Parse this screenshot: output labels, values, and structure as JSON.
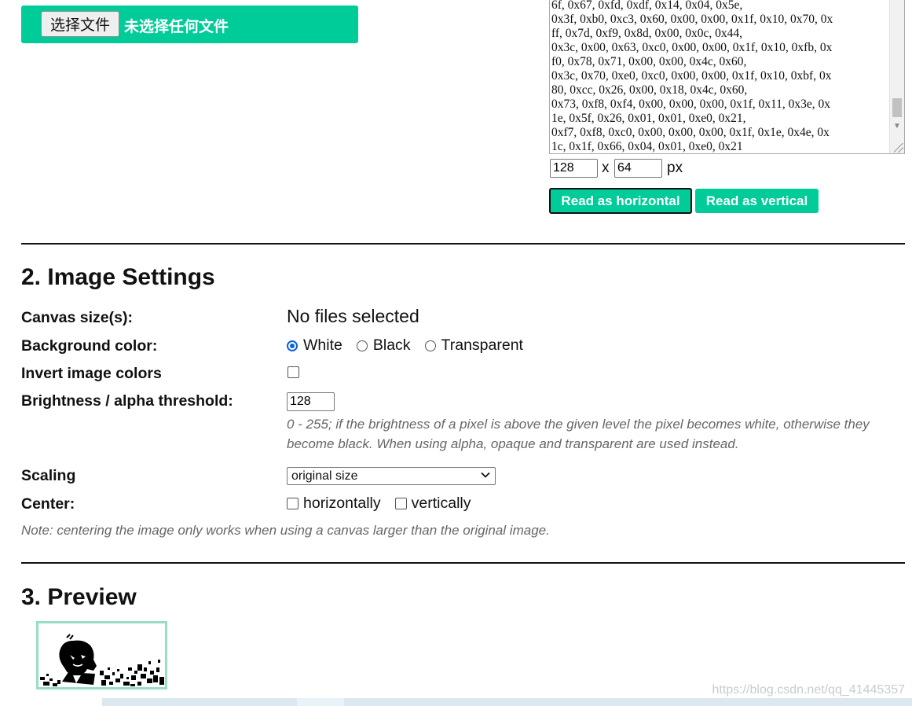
{
  "file_bar": {
    "choose_button": "选择文件",
    "no_file_text": "未选择任何文件"
  },
  "hex_output": {
    "lines": [
      "6f, 0x67, 0xfd, 0xdf, 0x14, 0x04, 0x5e,",
      "0x3f, 0xb0, 0xc3, 0x60, 0x00, 0x00, 0x1f, 0x10, 0x70, 0x",
      "ff, 0x7d, 0xf9, 0x8d, 0x00, 0x0c, 0x44,",
      "0x3c, 0x00, 0x63, 0xc0, 0x00, 0x00, 0x1f, 0x10, 0xfb, 0x",
      "f0, 0x78, 0x71, 0x00, 0x00, 0x4c, 0x60,",
      "0x3c, 0x70, 0xe0, 0xc0, 0x00, 0x00, 0x1f, 0x10, 0xbf, 0x",
      "80, 0xcc, 0x26, 0x00, 0x18, 0x4c, 0x60,",
      "0x73, 0xf8, 0xf4, 0x00, 0x00, 0x00, 0x1f, 0x11, 0x3e, 0x",
      "1e, 0x5f, 0x26, 0x01, 0x01, 0xe0, 0x21,",
      "0xf7, 0xf8, 0xc0, 0x00, 0x00, 0x00, 0x1f, 0x1e, 0x4e, 0x",
      "1c, 0x1f, 0x66, 0x04, 0x01, 0xe0, 0x21"
    ],
    "width_value": "128",
    "separator": "x",
    "height_value": "64",
    "unit": "px",
    "btn_horizontal": "Read as horizontal",
    "btn_vertical": "Read as vertical"
  },
  "image_settings": {
    "heading": "2. Image Settings",
    "canvas_label": "Canvas size(s):",
    "canvas_value": "No files selected",
    "bg_label": "Background color:",
    "bg_options": [
      "White",
      "Black",
      "Transparent"
    ],
    "bg_selected": "White",
    "invert_label": "Invert image colors",
    "threshold_label": "Brightness / alpha threshold:",
    "threshold_value": "128",
    "threshold_hint_line1": "0 - 255; if the brightness of a pixel is above the given level the pixel becomes white, otherwise they",
    "threshold_hint_line2": "become black. When using alpha, opaque and transparent are used instead.",
    "scaling_label": "Scaling",
    "scaling_value": "original size",
    "center_label": "Center:",
    "center_options": [
      "horizontally",
      "vertically"
    ],
    "center_note": "Note: centering the image only works when using a canvas larger than the original image."
  },
  "preview": {
    "heading": "3. Preview"
  },
  "watermark": "https://blog.csdn.net/qq_41445357",
  "colors": {
    "accent": "#00cc99",
    "preview_border": "#99ddc4",
    "radio_blue": "#0b62d6"
  }
}
